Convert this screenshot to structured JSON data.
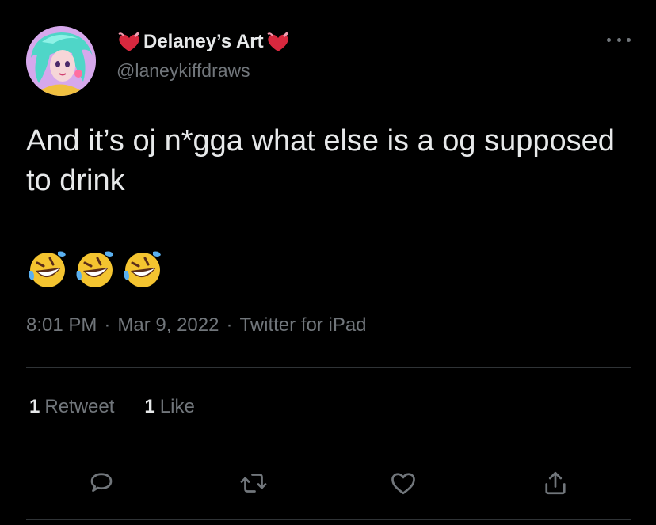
{
  "author": {
    "display_name": "Delaney’s Art",
    "handle": "@laneykiffdraws",
    "name_decoration_icon": "heart-with-ribbon-icon",
    "decoration_color": "#d8283e"
  },
  "tweet": {
    "text": "And it’s oj n*gga what else is a og supposed to drink",
    "emojis": [
      "rolling-on-floor-laughing-icon",
      "rolling-on-floor-laughing-icon",
      "rolling-on-floor-laughing-icon"
    ],
    "time": "8:01 PM",
    "date": "Mar 9, 2022",
    "source": "Twitter for iPad",
    "separator": "·"
  },
  "stats": {
    "retweets_count": "1",
    "retweets_label": "Retweet",
    "likes_count": "1",
    "likes_label": "Like"
  },
  "actions": [
    "reply-icon",
    "retweet-icon",
    "like-icon",
    "share-icon"
  ],
  "colors": {
    "background": "#000000",
    "primary_text": "#e7e9ea",
    "secondary_text": "#71767b",
    "divider": "#2f3336"
  }
}
